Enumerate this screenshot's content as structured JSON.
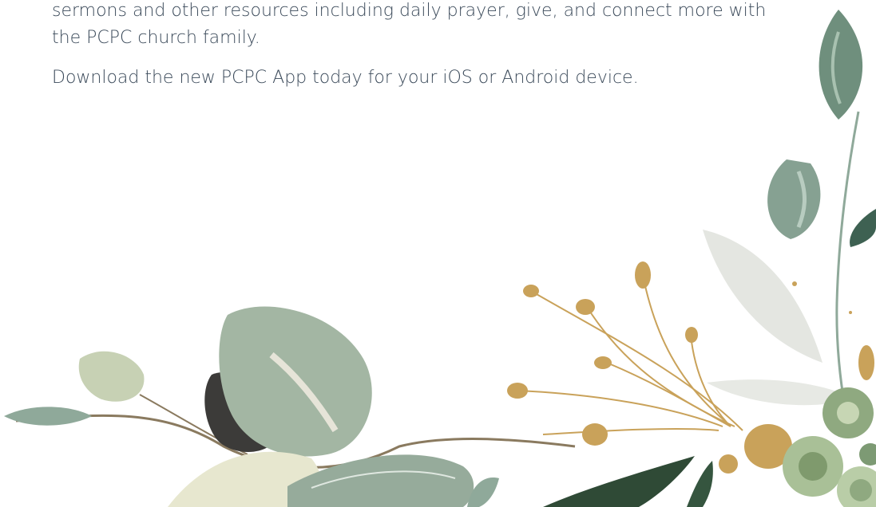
{
  "content": {
    "paragraph_1": "sermons and other resources including daily prayer, give, and connect more with the PCPC church family.",
    "paragraph_2": "Download the new PCPC App today for your iOS or Android device."
  },
  "illustration": {
    "description_icon": "eucalyptus-and-gold-leaf-icon",
    "colors": {
      "sage": "#a9b9a6",
      "sage_dark": "#7f9886",
      "forest": "#2f4a36",
      "charcoal": "#3c3b39",
      "cream": "#e7e7cf",
      "gold": "#c9a25a",
      "mist": "#e4e6e1"
    }
  }
}
